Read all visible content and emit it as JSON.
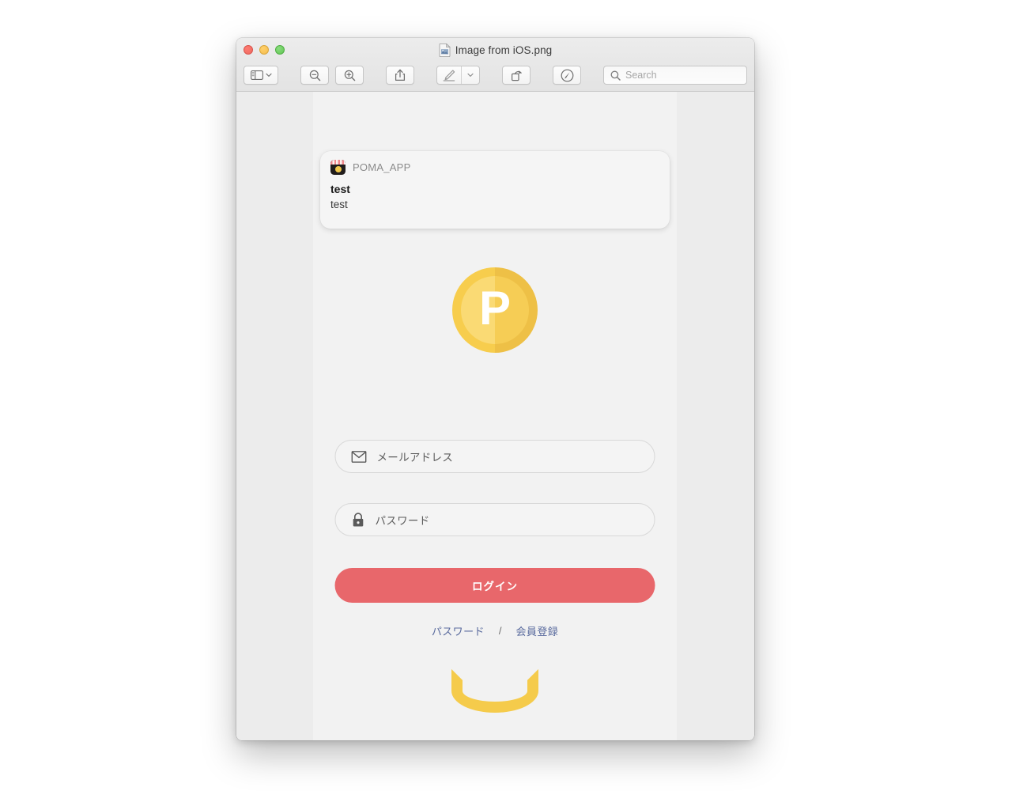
{
  "window": {
    "title": "Image from iOS.png",
    "title_icon": "image-document-icon",
    "traffic_lights": [
      "close-button",
      "minimize-button",
      "zoom-button"
    ]
  },
  "toolbar": {
    "sidebar_button": "sidebar-view-button",
    "sidebar_dropdown": "sidebar-view-dropdown",
    "zoom_out": "zoom-out-button",
    "zoom_in": "zoom-in-button",
    "share": "share-button",
    "markup": "markup-button",
    "markup_dropdown": "markup-dropdown",
    "rotate": "rotate-left-button",
    "annotate": "annotate-button",
    "search_placeholder": "Search",
    "search_value": ""
  },
  "notification": {
    "app_name": "POMA_APP",
    "title": "test",
    "body": "test",
    "app_icon": "poma-app-icon"
  },
  "app": {
    "logo_letter": "P",
    "logo_color": "#f7cd4d",
    "email": {
      "placeholder": "メールアドレス",
      "value": "",
      "icon": "envelope-icon"
    },
    "password": {
      "placeholder": "パスワード",
      "value": "",
      "icon": "lock-icon"
    },
    "login_button": {
      "label": "ログイン",
      "color": "#e8676b"
    },
    "links": {
      "password_reset": "パスワード",
      "separator": "/",
      "register": "会員登録",
      "color": "#5a6b9e"
    },
    "footer_arc_color": "#f5cb4b"
  }
}
